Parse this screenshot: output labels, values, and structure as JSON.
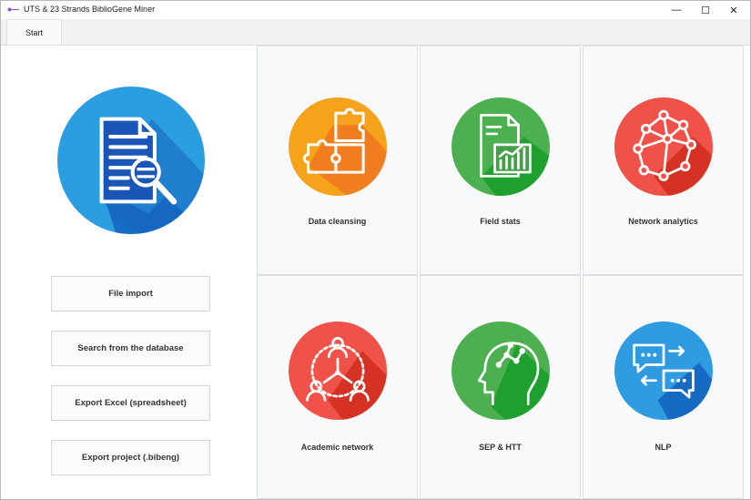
{
  "window": {
    "title": "UTS & 23 Strands BiblioGene Miner",
    "controls": {
      "minimize": "—",
      "maximize": "☐",
      "close": "✕"
    }
  },
  "tabs": [
    {
      "label": "Start"
    }
  ],
  "sidebar": {
    "main_icon": "document-search-icon",
    "buttons": [
      {
        "label": "File import"
      },
      {
        "label": "Search from the database"
      },
      {
        "label": "Export Excel (spreadsheet)"
      },
      {
        "label": "Export project (.bibeng)"
      }
    ]
  },
  "tiles": [
    {
      "label": "Data cleansing",
      "icon": "puzzle-icon",
      "color": "#f7a21b"
    },
    {
      "label": "Field stats",
      "icon": "report-chart-icon",
      "color": "#4caf50"
    },
    {
      "label": "Network analytics",
      "icon": "network-graph-icon",
      "color": "#f0524a"
    },
    {
      "label": "Academic network",
      "icon": "people-network-icon",
      "color": "#f0524a"
    },
    {
      "label": "SEP & HTT",
      "icon": "head-brain-icon",
      "color": "#4caf50"
    },
    {
      "label": "NLP",
      "icon": "chat-bubbles-icon",
      "color": "#2f9be0"
    }
  ]
}
